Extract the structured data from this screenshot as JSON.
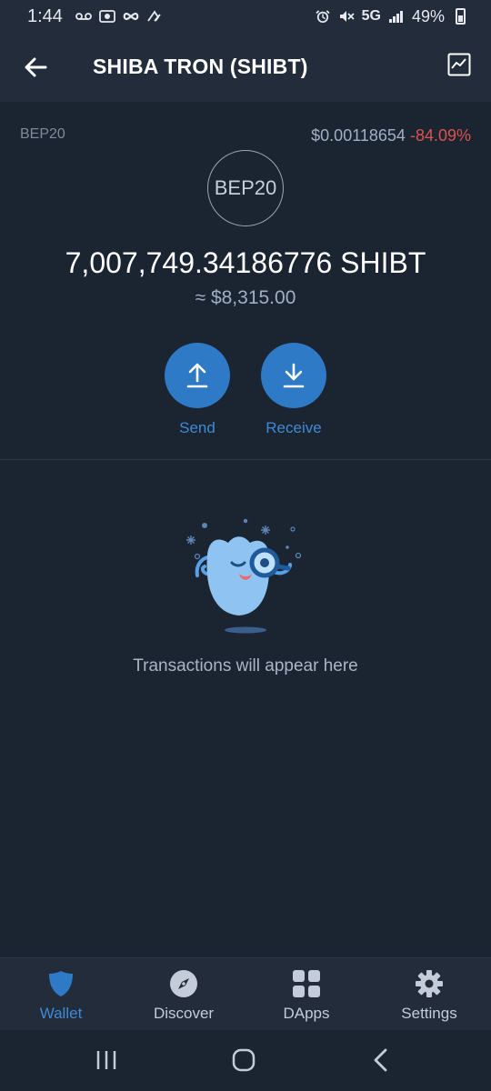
{
  "status_bar": {
    "time": "1:44",
    "network": "5G",
    "battery": "49%"
  },
  "header": {
    "title": "SHIBA TRON (SHIBT)"
  },
  "token": {
    "network_label": "BEP20",
    "price": "$0.00118654",
    "change": "-84.09%",
    "logo_text": "BEP20",
    "balance": "7,007,749.34186776 SHIBT",
    "fiat_value": "≈ $8,315.00"
  },
  "actions": {
    "send_label": "Send",
    "receive_label": "Receive"
  },
  "empty_state": {
    "text": "Transactions will appear here"
  },
  "bottom_nav": {
    "items": [
      {
        "label": "Wallet",
        "icon": "shield-icon",
        "active": true
      },
      {
        "label": "Discover",
        "icon": "compass-icon",
        "active": false
      },
      {
        "label": "DApps",
        "icon": "grid-icon",
        "active": false
      },
      {
        "label": "Settings",
        "icon": "gear-icon",
        "active": false
      }
    ]
  },
  "colors": {
    "background": "#1b2431",
    "bar": "#222c3a",
    "accent": "#2f7ac6",
    "negative": "#d9534f"
  }
}
